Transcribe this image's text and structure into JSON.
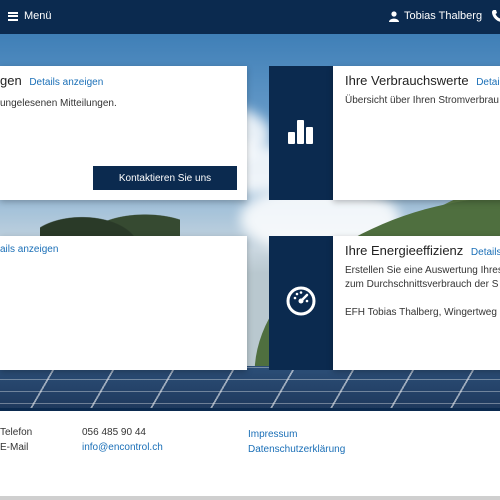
{
  "header": {
    "menu_label": "Menü",
    "user_name": "Tobias Thalberg"
  },
  "cards": {
    "messages": {
      "title_fragment": "gen",
      "details": "Details anzeigen",
      "text": "ungelesenen Mitteilungen.",
      "button": "Kontaktieren Sie uns"
    },
    "consumption": {
      "title": "Ihre Verbrauchswerte",
      "details": "Details",
      "text": "Übersicht über Ihren Stromverbrau"
    },
    "lower_left": {
      "details": "ails anzeigen"
    },
    "efficiency": {
      "title": "Ihre Energieeffizienz",
      "details": "Details a",
      "text_line1": "Erstellen Sie eine Auswertung Ihres",
      "text_line2": "zum Durchschnittsverbrauch der S",
      "building": "EFH Tobias Thalberg, Wingertweg"
    }
  },
  "footer": {
    "phone_label": "Telefon",
    "phone_value": "056 485 90 44",
    "email_label": "E-Mail",
    "email_value": "info@encontrol.ch",
    "impressum": "Impressum",
    "privacy": "Datenschutzerklärung"
  },
  "colors": {
    "brand_navy": "#0b2a4f",
    "link_blue": "#1a6fb7"
  },
  "icons": [
    "hamburger-icon",
    "user-icon",
    "phone-icon",
    "bar-chart-icon",
    "speedometer-icon"
  ]
}
